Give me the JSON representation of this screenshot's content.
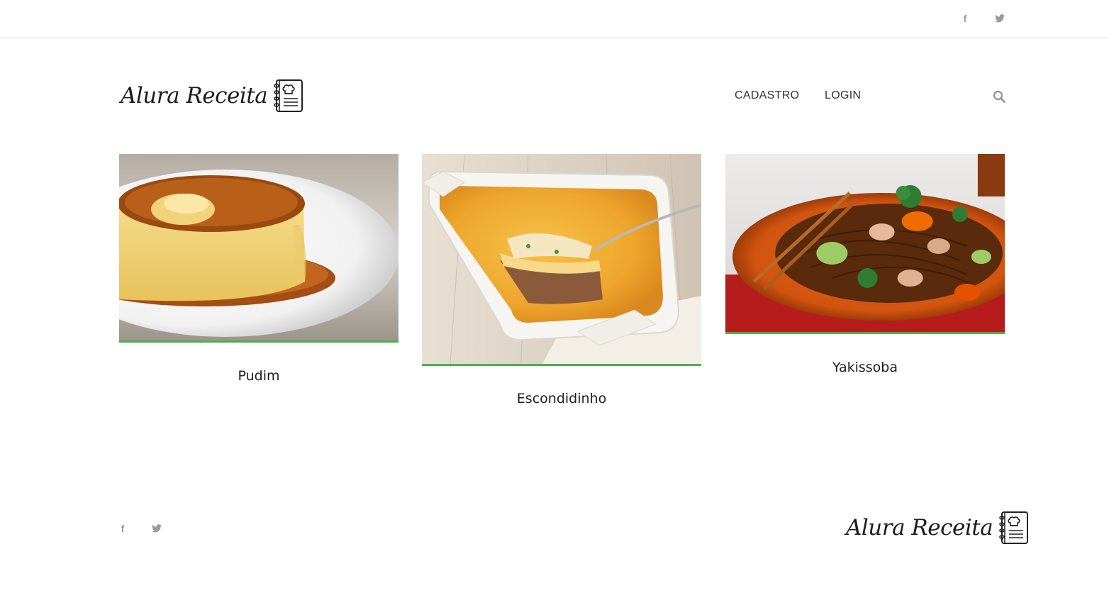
{
  "brand": {
    "name": "Alura Receita"
  },
  "topbar": {
    "icons": [
      "facebook-icon",
      "twitter-icon"
    ]
  },
  "nav": {
    "items": [
      {
        "label": "CADASTRO"
      },
      {
        "label": "LOGIN"
      }
    ],
    "search_icon": "search-icon"
  },
  "recipes": [
    {
      "title": "Pudim",
      "image": "pudim-photo"
    },
    {
      "title": "Escondidinho",
      "image": "escondidinho-photo"
    },
    {
      "title": "Yakissoba",
      "image": "yakissoba-photo"
    }
  ],
  "colors": {
    "accent": "#4cb04f",
    "icon_gray": "#9a9a9a",
    "text": "#333333",
    "border": "#e3e3e3"
  },
  "footer": {
    "icons": [
      "facebook-icon",
      "twitter-icon"
    ]
  }
}
